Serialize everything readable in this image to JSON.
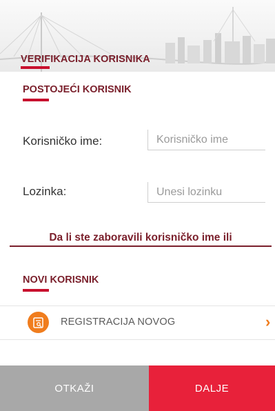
{
  "header": {
    "title": "VERIFIKACIJA KORISNIKA"
  },
  "existing_user": {
    "section_title": "POSTOJEĆI KORISNIK",
    "username": {
      "label": "Korisničko ime:",
      "placeholder": "Korisničko ime",
      "value": ""
    },
    "password": {
      "label": "Lozinka:",
      "placeholder": "Unesi lozinku",
      "value": ""
    },
    "forgot_link": "Da li ste zaboravili korisničko ime ili"
  },
  "new_user": {
    "section_title": "NOVI KORISNIK",
    "register_label": "REGISTRACIJA NOVOG",
    "register_icon": "registration-form-icon",
    "chevron_icon": "chevron-right-icon"
  },
  "footer": {
    "cancel_label": "OTKAŽI",
    "next_label": "DALJE"
  },
  "colors": {
    "brand_dark_red": "#7a1f2b",
    "accent_red": "#c8102e",
    "primary_button": "#e8213a",
    "secondary_button": "#a8a8a8",
    "icon_orange": "#f07d1e"
  }
}
